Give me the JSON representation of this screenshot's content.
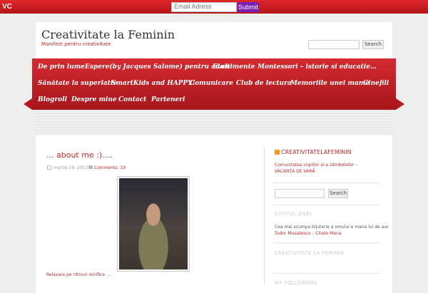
{
  "topbar": {
    "logo": "VC",
    "email_placeholder": "Email Adress",
    "submit_label": "Submit",
    "bg_color": "#c91f24",
    "submit_color": "#7a1fb5"
  },
  "header": {
    "title": "Creativitate la Feminin",
    "tagline": "Manifest pentru creativitate",
    "search_button": "Search"
  },
  "nav": {
    "items": [
      "De prin lume",
      "Espere(by Jacques Salome) pentru adulti",
      "Evenimente",
      "Montessori – istorie si educatie…",
      "Sănătate la superlativ",
      "SmartKids and HAPPY!",
      "Comunicare",
      "Club de lectura",
      "Memoriile unei mame",
      "Cinefili",
      "Blogroll",
      "Despre mine",
      "Contact",
      "Parteneri"
    ]
  },
  "post": {
    "title": "... about me :)....",
    "date": "martie 19, 2013",
    "comments": "Comments: 19",
    "excerpt": "Relaxare pe ritmuri mirifice ...."
  },
  "sidebar": {
    "rss_title": "CREATIVITATELAFEMININ",
    "rss_link": "Comunitatea copiilor și-a zâmbetelor – VACANȚA DE VARĂ",
    "search_button": "Search",
    "citatul_title": "CITATUL ZILEI",
    "quote": "Cea mai scumpa bijuterie a omului e mana lui de aur.",
    "quote_author": "Tudor Musatescu – Citate Mana",
    "creativitate_title": "CREATIVITATE LA FEMININ",
    "followers_title": "MY FOLLOWERS"
  }
}
